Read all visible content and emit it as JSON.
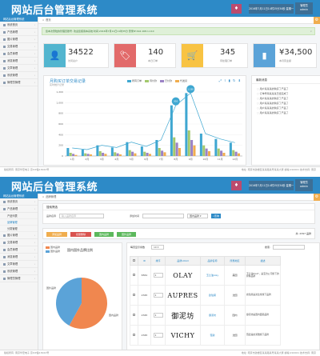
{
  "app": {
    "logo": "网站后台管理系统",
    "header_time": "2016年7月11日14时25分34秒 星期一",
    "user_role": "管理员",
    "username": "admin"
  },
  "colors": {
    "header": "#2d8ac7",
    "stat_teal": "#52b5cf",
    "stat_red": "#e26a6a",
    "stat_yellow": "#f8c343",
    "stat_blue": "#5ba3d8"
  },
  "sidebar1": {
    "head": "网站后台管理系统",
    "items": [
      {
        "label": "系统首页",
        "icon": "home-icon"
      },
      {
        "label": "产品管理",
        "icon": "box-icon"
      },
      {
        "label": "图片管理",
        "icon": "image-icon"
      },
      {
        "label": "交易管理",
        "icon": "trade-icon"
      },
      {
        "label": "会员管理",
        "icon": "user-icon"
      },
      {
        "label": "消息管理",
        "icon": "message-icon"
      },
      {
        "label": "文章管理",
        "icon": "article-icon"
      },
      {
        "label": "系统管理",
        "icon": "gear-icon"
      },
      {
        "label": "管理员管理",
        "icon": "admin-icon"
      }
    ]
  },
  "dashboard": {
    "breadcrumb": "首页",
    "alert": "您本次登陆的管理员账号: 欢迎您使用本系统 时间:2016年7月11日11时35分 登录IP:192.168.1.110",
    "stats": [
      {
        "value": "34522",
        "label": "访问总户"
      },
      {
        "value": "140",
        "label": "本日订单"
      },
      {
        "value": "345",
        "label": "待处理订单"
      },
      {
        "value": "¥34,500",
        "label": "本月营业额"
      }
    ],
    "chart_title": "月购买订单交易记录",
    "chart_subtitle": "实时统计记录",
    "news_title": "最新消息",
    "news": [
      "用户某某某的购买了产品了",
      "订单号码某某某已经完成了",
      "用户某某某的购买了产品了",
      "用户某某某的购买了产品了",
      "用户某某某的购买了产品了",
      "用户某某某的购买了产品了"
    ],
    "footer_left": "版权所有: 南京华宏电子 京ICP备13022号",
    "footer_right": "地址: 南京市鼓楼区某某路某号某某大厦 邮编:210001 技术支持: 南京"
  },
  "chart_data": {
    "type": "bar",
    "title": "月购买订单交易记录",
    "subtitle": "实时统计记录",
    "categories": [
      "1月",
      "2月",
      "3月",
      "4月",
      "5月",
      "6月",
      "7月",
      "8月",
      "9月",
      "10月",
      "11月",
      "12月"
    ],
    "series": [
      {
        "name": "所有订单",
        "color": "#3fa7d1",
        "values": [
          150,
          120,
          200,
          160,
          260,
          180,
          300,
          950,
          1180,
          420,
          320,
          250
        ]
      },
      {
        "name": "待付款",
        "color": "#a3c86d",
        "values": [
          60,
          50,
          90,
          70,
          110,
          80,
          150,
          350,
          480,
          200,
          140,
          110
        ]
      },
      {
        "name": "已付款",
        "color": "#9b82c5",
        "values": [
          40,
          40,
          60,
          50,
          80,
          60,
          100,
          250,
          300,
          140,
          100,
          80
        ]
      },
      {
        "name": "代发货",
        "color": "#f0ad4e",
        "values": [
          20,
          30,
          40,
          30,
          50,
          40,
          70,
          150,
          200,
          90,
          60,
          50
        ]
      }
    ],
    "line": {
      "name": "所有订单",
      "values": [
        150,
        120,
        200,
        160,
        260,
        180,
        300,
        950,
        1180,
        420,
        320,
        250
      ]
    },
    "ylim": [
      0,
      1200
    ],
    "yticks": [
      "0",
      "200",
      "400",
      "600",
      "800",
      "1,000",
      "1,200"
    ],
    "annotations": [
      {
        "x": "9月",
        "value": "1,180"
      },
      {
        "x": "8月",
        "value": "950"
      }
    ],
    "legend_position": "top-center"
  },
  "sidebar2": {
    "items_top": [
      {
        "label": "系统首页",
        "icon": "home-icon"
      },
      {
        "label": "产品管理",
        "icon": "box-icon"
      }
    ],
    "subitems": [
      "产品列表",
      "品牌管理",
      "分类管理"
    ],
    "items_bottom": [
      {
        "label": "图片管理",
        "icon": "image-icon"
      },
      {
        "label": "交易管理",
        "icon": "trade-icon"
      },
      {
        "label": "会员管理",
        "icon": "user-icon"
      },
      {
        "label": "消息管理",
        "icon": "message-icon"
      },
      {
        "label": "文章管理",
        "icon": "article-icon"
      },
      {
        "label": "系统管理",
        "icon": "gear-icon"
      },
      {
        "label": "管理员管理",
        "icon": "admin-icon"
      }
    ]
  },
  "brands": {
    "breadcrumb": "品牌管理",
    "search_title": "搜索筛选",
    "name_label": "品牌名称",
    "name_placeholder": "输入品牌名称",
    "date_label": "添加时间",
    "date_placeholder": "",
    "country_select": "国内品牌",
    "query_button": "查询",
    "buttons": [
      "添加品牌",
      "批量删除",
      "国内品牌",
      "国外品牌"
    ],
    "total": "共: 2397 品牌",
    "pie_legend": [
      "国内品牌",
      "国外品牌"
    ],
    "pie_title": "国内国外品牌比例",
    "pie_labels": [
      "国外品牌",
      "国内品牌"
    ],
    "show_label": "每页显示条数",
    "per_page": "10",
    "search_label": "搜索:",
    "columns": [
      "",
      "ID",
      "排序",
      "品牌LOGO",
      "品牌名称",
      "所属地区",
      "描述"
    ],
    "rows": [
      {
        "id": "6561",
        "sort": "1",
        "logo": "OLAY",
        "name": "玉兰油olay",
        "region": "美国",
        "desc": "玉兰油OLAY，是宝洁公司旗下的护肤品牌"
      },
      {
        "id": "2345",
        "sort": "1",
        "logo": "AUPRES",
        "name": "欧珀莱",
        "region": "法国",
        "desc": "欧珀莱是资生堂旗下品牌"
      },
      {
        "id": "2345",
        "sort": "1",
        "logo": "御泥坊",
        "name": "御泥坊",
        "region": "国内",
        "desc": "御泥坊是国内面膜品牌"
      },
      {
        "id": "2345",
        "sort": "1",
        "logo": "VICHY",
        "name": "薇姿",
        "region": "法国",
        "desc": "薇姿是欧莱雅旗下品牌"
      }
    ],
    "footer_left": "版权所有: 南京华宏电子 京ICP备13022号",
    "footer_right": "地址: 南京市鼓楼区某某路某号某某大厦 邮编:210001 技术支持: 南京"
  },
  "pie_data": {
    "type": "pie",
    "slices": [
      {
        "label": "国内品牌",
        "value": 58,
        "color": "#f0874f"
      },
      {
        "label": "国外品牌",
        "value": 42,
        "color": "#5ba3d8"
      }
    ]
  }
}
